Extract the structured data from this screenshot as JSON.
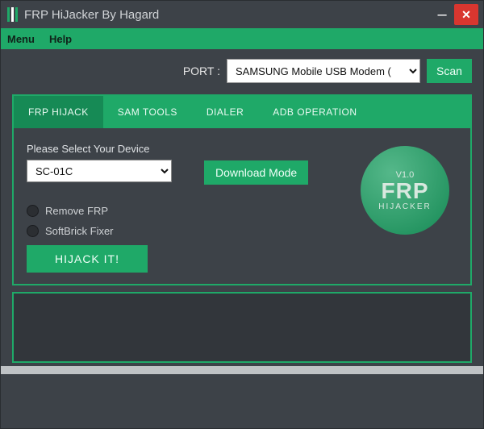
{
  "window": {
    "title": "FRP HiJacker By Hagard",
    "minimize": "–",
    "close": "✕"
  },
  "menu": {
    "menu": "Menu",
    "help": "Help"
  },
  "port": {
    "label": "PORT :",
    "selected": "SAMSUNG Mobile USB Modem (",
    "scan": "Scan"
  },
  "tabs": {
    "frp": "FRP HIJACK",
    "sam": "SAM TOOLS",
    "dialer": "DIALER",
    "adb": "ADB OPERATION"
  },
  "panel": {
    "device_label": "Please Select Your Device",
    "device_value": "SC-01C",
    "download_mode": "Download Mode",
    "remove_frp": "Remove FRP",
    "softbrick": "SoftBrick Fixer",
    "hijack_it": "HIJACK IT!"
  },
  "logo": {
    "version": "V1.0",
    "main": "FRP",
    "sub": "HIJACKER"
  }
}
